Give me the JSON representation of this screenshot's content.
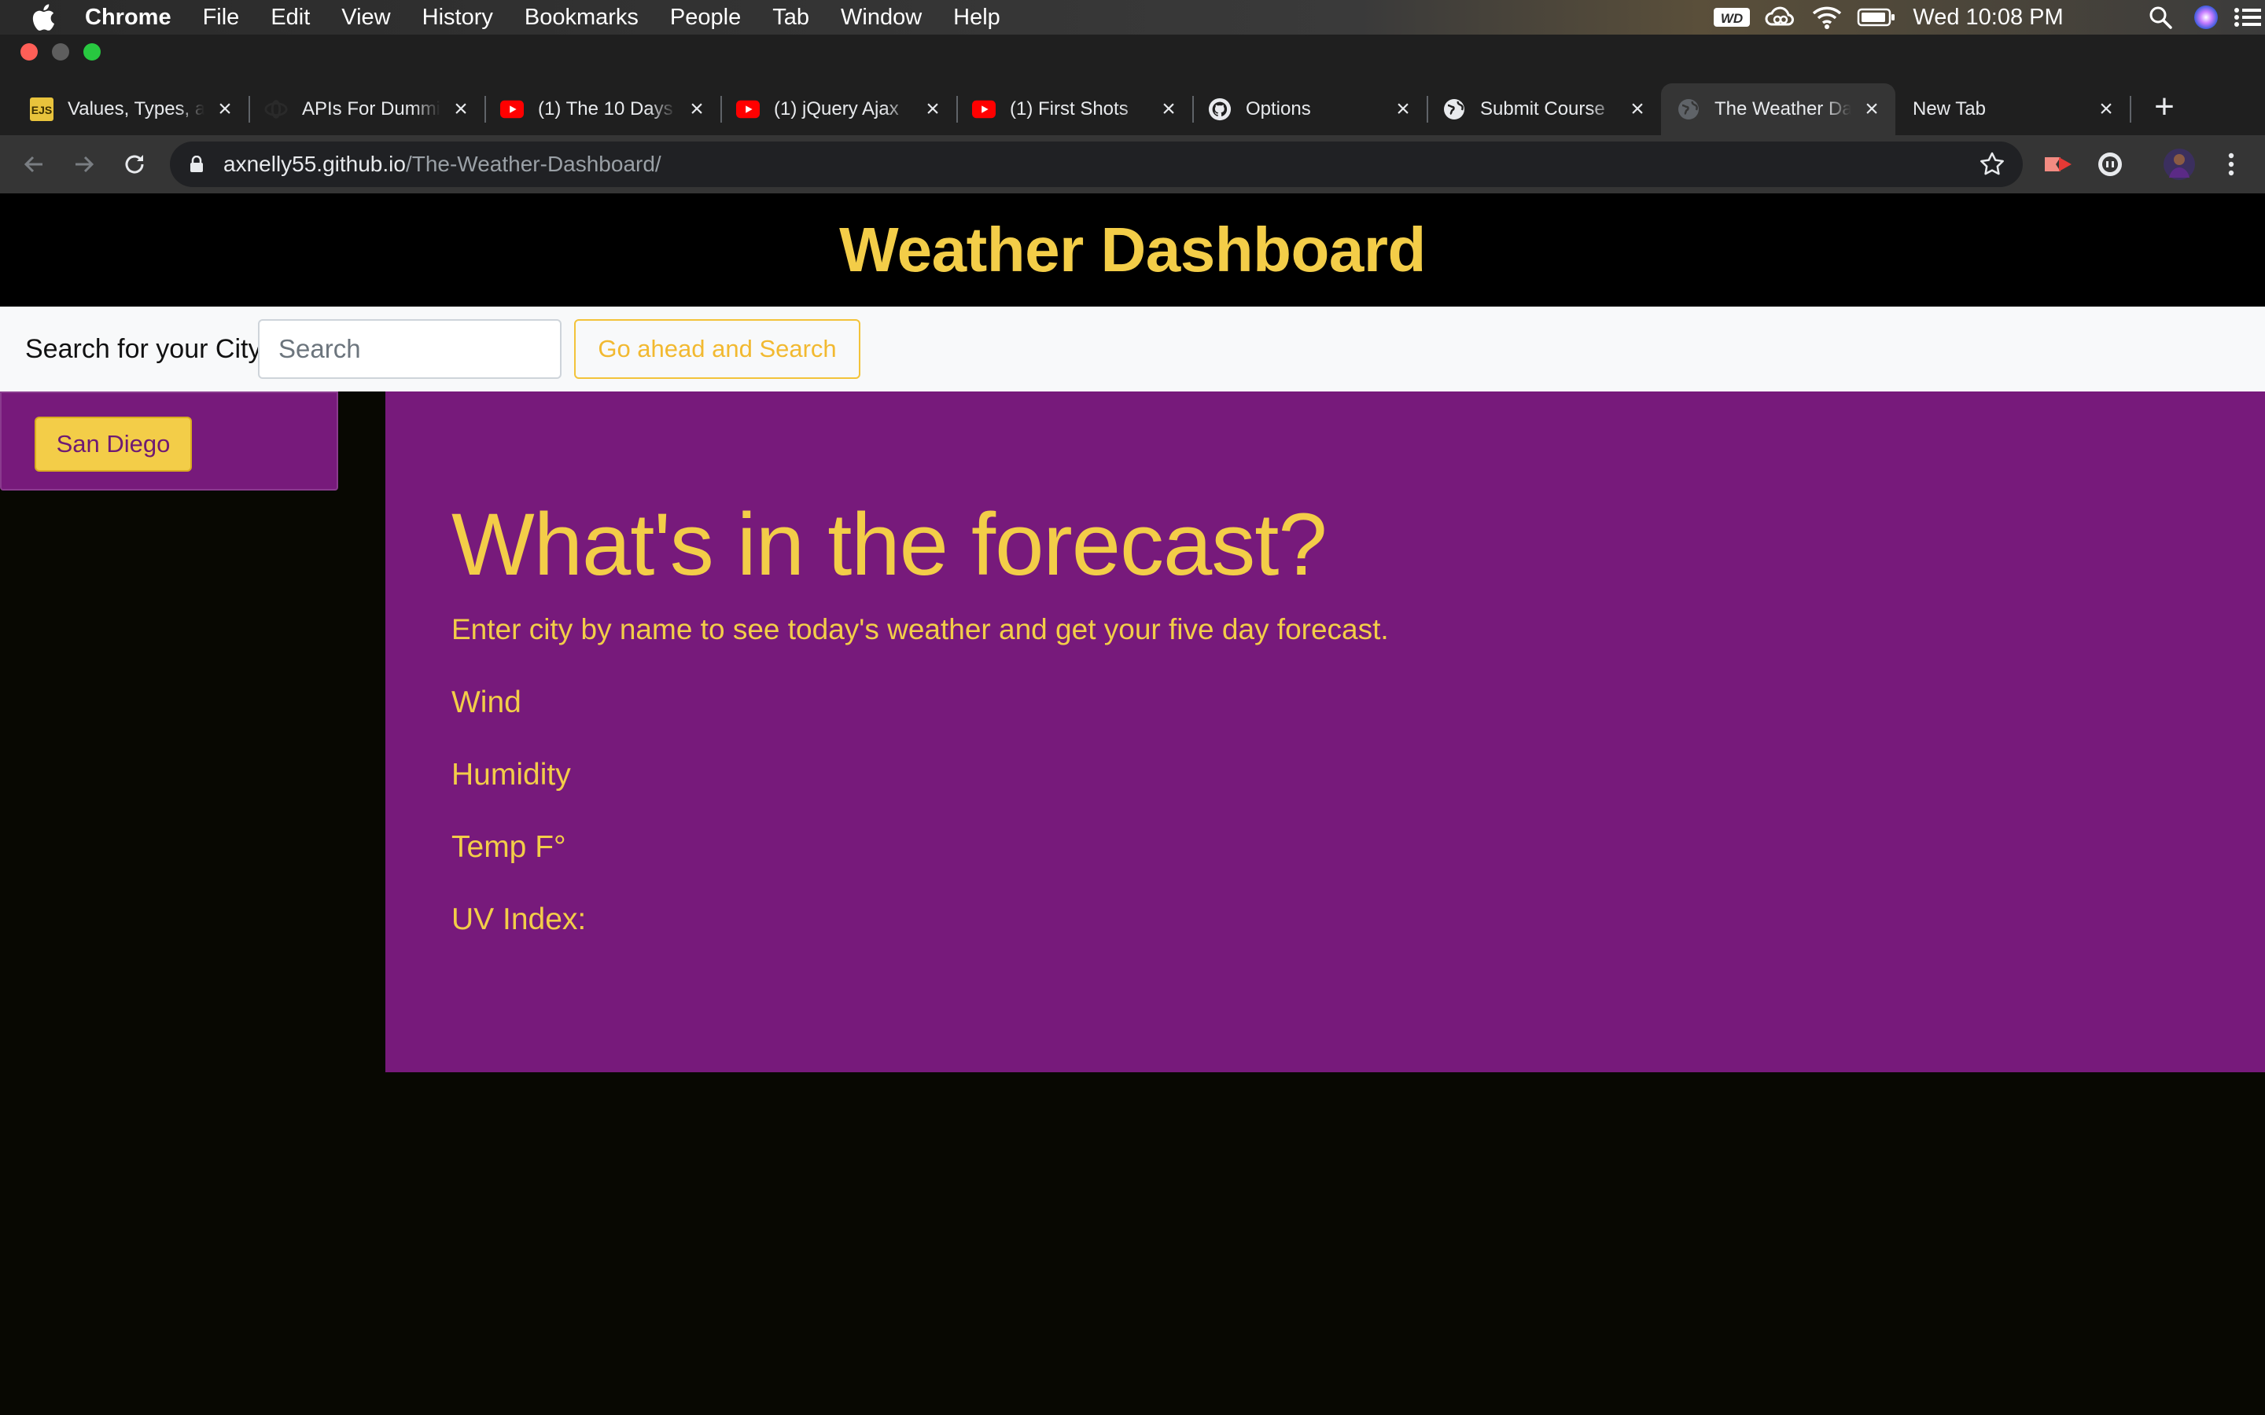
{
  "menubar": {
    "app_name": "Chrome",
    "items": [
      "File",
      "Edit",
      "View",
      "History",
      "Bookmarks",
      "People",
      "Tab",
      "Window",
      "Help"
    ],
    "clock": "Wed 10:08 PM",
    "status_icons": [
      "wd-drive-icon",
      "creative-cloud-icon",
      "wifi-icon",
      "battery-icon",
      "spotlight-search-icon",
      "siri-icon",
      "notification-center-icon"
    ],
    "wd_label": "WD"
  },
  "tabs": [
    {
      "title": "Values, Types, and Operators",
      "favicon": "ejs-icon",
      "active": false
    },
    {
      "title": "APIs For Dummies",
      "favicon": "apis-icon",
      "active": false
    },
    {
      "title": "(1) The 10 Days",
      "favicon": "youtube-icon",
      "active": false
    },
    {
      "title": "(1) jQuery Ajax",
      "favicon": "youtube-icon",
      "active": false
    },
    {
      "title": "(1) First Shots",
      "favicon": "youtube-icon",
      "active": false
    },
    {
      "title": "Options",
      "favicon": "github-icon",
      "active": false
    },
    {
      "title": "Submit Course",
      "favicon": "globe-icon",
      "active": false
    },
    {
      "title": "The Weather Dashboard",
      "favicon": "globe-icon",
      "active": true
    },
    {
      "title": "New Tab",
      "favicon": "",
      "active": false
    }
  ],
  "ejs_label": "EJS",
  "address_bar": {
    "host": "axnelly55.github.io",
    "path": "/The-Weather-Dashboard/"
  },
  "colors": {
    "accent_gold": "#f3cd48",
    "panel_purple": "#771a7b",
    "page_bg": "#080802"
  },
  "page": {
    "title": "Weather Dashboard",
    "search_label": "Search for your City:",
    "search_placeholder": "Search",
    "search_button": "Go ahead and Search",
    "history": [
      "San Diego"
    ],
    "forecast": {
      "heading": "What's in the forecast?",
      "lead": "Enter city by name to see today's weather and get your five day forecast.",
      "wind": "Wind",
      "humidity": "Humidity",
      "temp": "Temp F°",
      "uv": "UV Index:"
    }
  }
}
